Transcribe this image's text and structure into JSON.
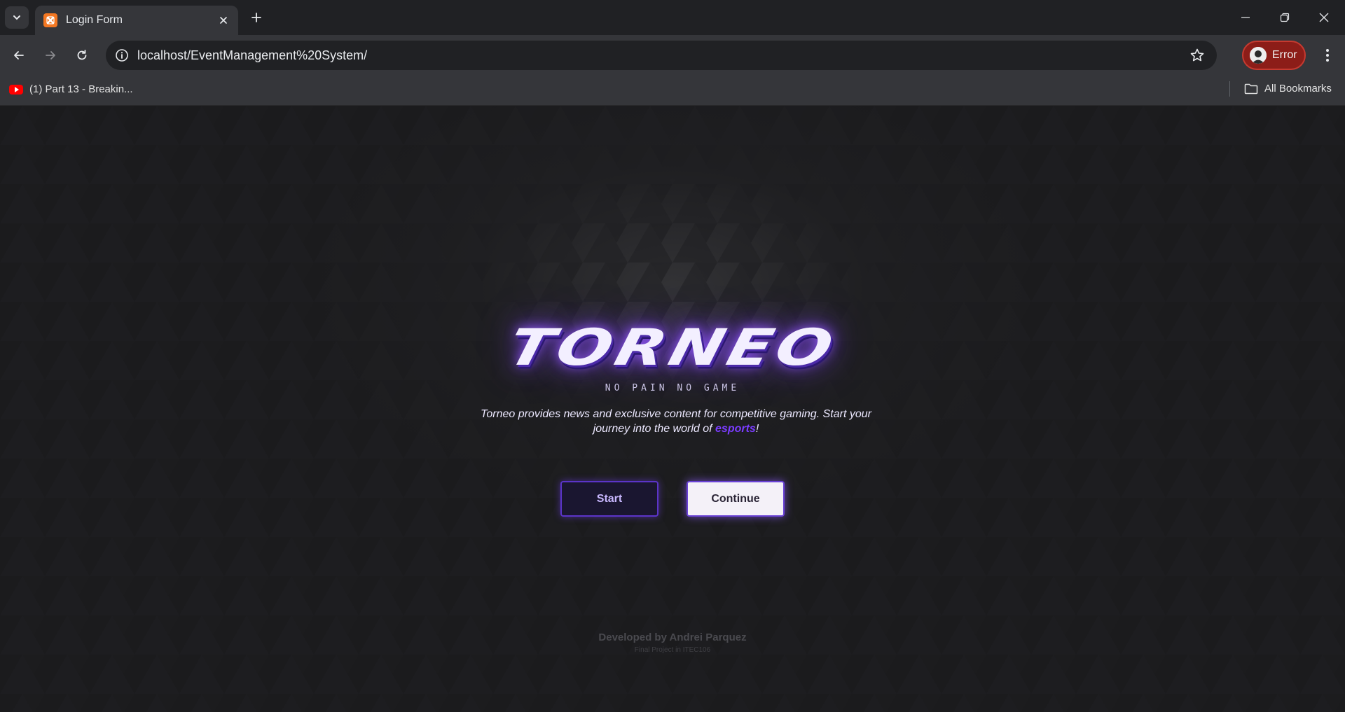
{
  "browser": {
    "tab": {
      "title": "Login Form"
    },
    "url": "localhost/EventManagement%20System/",
    "profile": {
      "label": "Error"
    },
    "bookmarks": {
      "items": [
        {
          "label": "(1) Part 13 - Breakin..."
        }
      ],
      "all_label": "All Bookmarks"
    }
  },
  "page": {
    "logo": "TORNEO",
    "tagline": "NO PAIN NO GAME",
    "description": {
      "before": "Torneo provides news and exclusive content for competitive gaming. Start your journey into the world of ",
      "highlight": "esports",
      "after": "!"
    },
    "buttons": {
      "start": "Start",
      "continue": "Continue"
    },
    "footer": {
      "credit": "Developed by Andrei Parquez",
      "subtitle": "Final Project in ITEC106"
    },
    "colors": {
      "accent": "#7a3cff",
      "background": "#1b1b1d",
      "profile_error": "#8c1d18"
    }
  }
}
